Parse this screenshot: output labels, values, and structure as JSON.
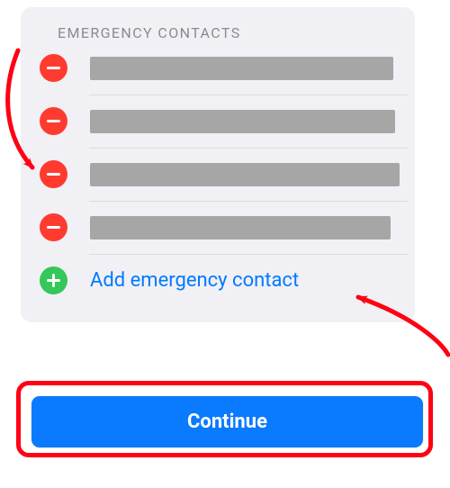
{
  "section": {
    "header": "EMERGENCY CONTACTS",
    "contacts": [
      {
        "name": "(redacted)"
      },
      {
        "name": "(redacted)"
      },
      {
        "name": "(redacted)"
      },
      {
        "name": "(redacted)"
      }
    ],
    "add_label": "Add emergency contact"
  },
  "cta": {
    "label": "Continue"
  },
  "colors": {
    "remove": "#ff3b30",
    "add": "#34c759",
    "link": "#007aff",
    "cta": "#0a7aff",
    "annotation": "#ff0014"
  }
}
